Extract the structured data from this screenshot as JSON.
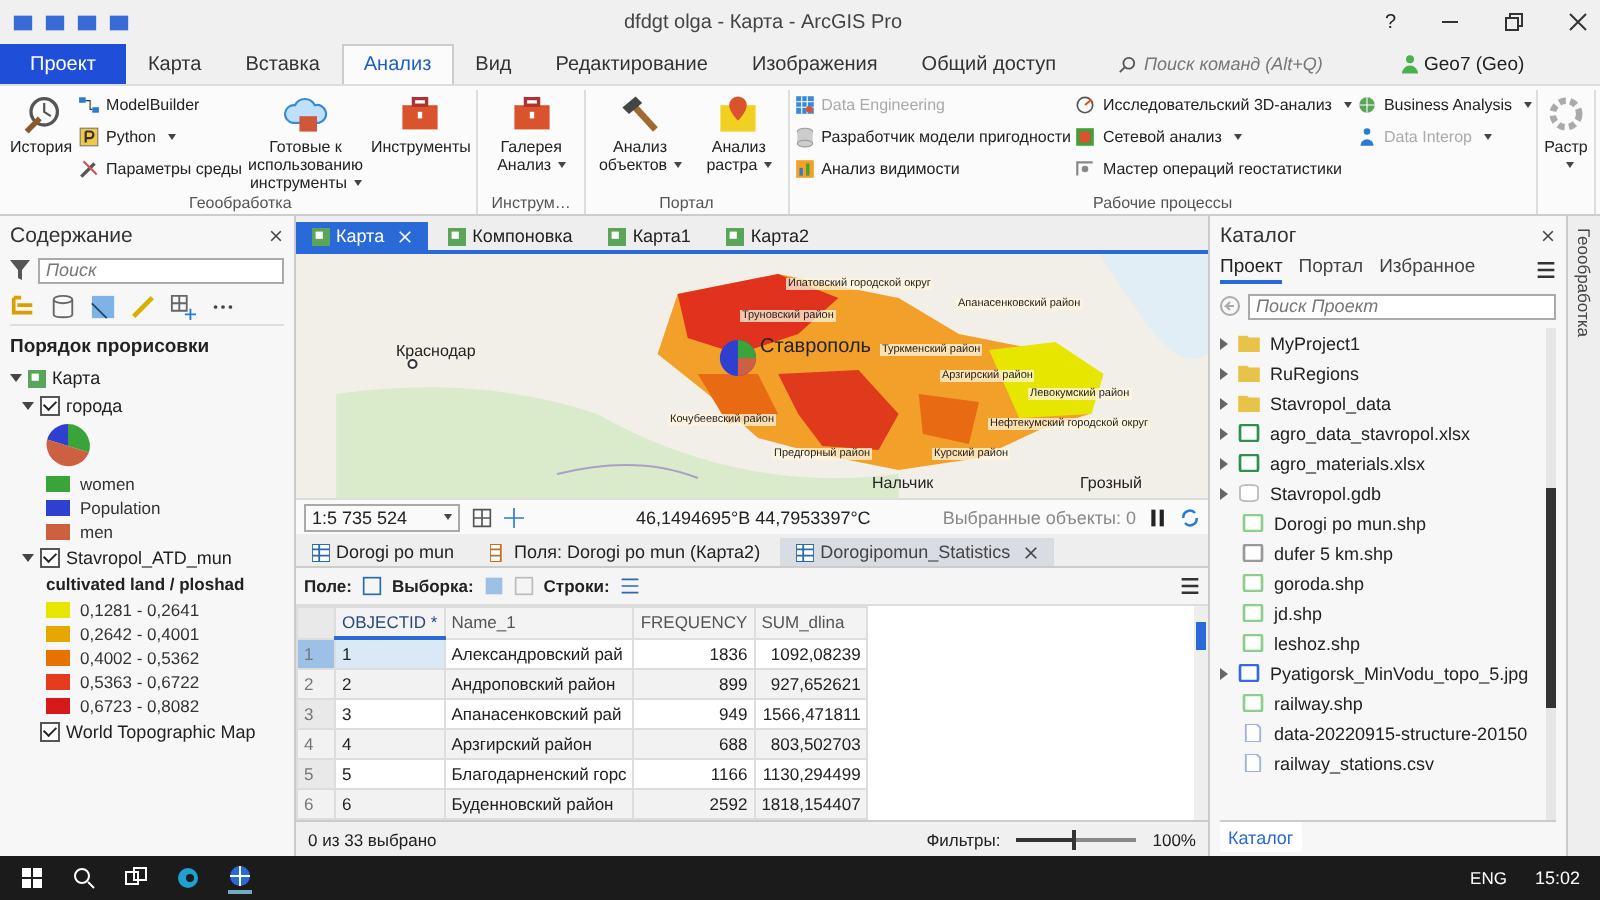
{
  "window": {
    "title": "dfdgt olga - Карта - ArcGIS Pro",
    "help": "?"
  },
  "ribbon_tabs": [
    {
      "label": "Проект",
      "kind": "file",
      "selected": false
    },
    {
      "label": "Карта",
      "kind": "tab",
      "selected": false
    },
    {
      "label": "Вставка",
      "kind": "tab",
      "selected": false
    },
    {
      "label": "Анализ",
      "kind": "tab",
      "selected": true
    },
    {
      "label": "Вид",
      "kind": "tab",
      "selected": false
    },
    {
      "label": "Редактирование",
      "kind": "tab",
      "selected": false
    },
    {
      "label": "Изображения",
      "kind": "tab",
      "selected": false
    },
    {
      "label": "Общий доступ",
      "kind": "tab",
      "selected": false
    }
  ],
  "command_search": {
    "placeholder": "Поиск команд (Alt+Q)"
  },
  "user": {
    "name": "Geo7 (Geo)"
  },
  "ribbon_groups": [
    {
      "title": "Геообработка",
      "columns": [
        {
          "kind": "large",
          "label": "История",
          "dropdown": false
        },
        {
          "kind": "stack",
          "items": [
            {
              "label": "ModelBuilder",
              "dropdown": false,
              "disabled": false
            },
            {
              "label": "Python",
              "dropdown": true,
              "disabled": false
            },
            {
              "label": "Параметры среды",
              "dropdown": false,
              "disabled": false
            }
          ]
        },
        {
          "kind": "large",
          "label": "Готовые к использованию инструменты",
          "dropdown": true
        },
        {
          "kind": "large",
          "label": "Инструменты",
          "dropdown": false
        }
      ]
    },
    {
      "title": "Инструм…",
      "columns": [
        {
          "kind": "large",
          "label": "Галерея Анализ",
          "dropdown": true
        }
      ]
    },
    {
      "title": "Портал",
      "columns": [
        {
          "kind": "large",
          "label": "Анализ объектов",
          "dropdown": true
        },
        {
          "kind": "large",
          "label": "Анализ растра",
          "dropdown": true
        }
      ]
    },
    {
      "title": "Рабочие процессы",
      "columns": [
        {
          "kind": "stack",
          "items": [
            {
              "label": "Data Engineering",
              "dropdown": false,
              "disabled": true
            },
            {
              "label": "Разработчик модели пригодности",
              "dropdown": false,
              "disabled": false
            },
            {
              "label": "Анализ видимости",
              "dropdown": false,
              "disabled": false
            }
          ]
        },
        {
          "kind": "stack",
          "items": [
            {
              "label": "Исследовательский 3D-анализ",
              "dropdown": true,
              "disabled": false
            },
            {
              "label": "Сетевой анализ",
              "dropdown": true,
              "disabled": false
            },
            {
              "label": "Мастер операций геостатистики",
              "dropdown": false,
              "disabled": false
            }
          ]
        },
        {
          "kind": "stack",
          "items": [
            {
              "label": "Business Analysis",
              "dropdown": true,
              "disabled": false
            },
            {
              "label": "Data Interop",
              "dropdown": true,
              "disabled": true
            }
          ]
        }
      ]
    },
    {
      "columns": [
        {
          "kind": "large",
          "label": "Растр",
          "dropdown": true
        }
      ]
    }
  ],
  "contents_pane": {
    "title": "Содержание",
    "search": {
      "placeholder": "Поиск"
    },
    "heading": "Порядок прорисовки",
    "tree": [
      {
        "label": "Карта",
        "kind": "map",
        "expanded": true,
        "children": [
          {
            "label": "города",
            "kind": "layer",
            "checked": true,
            "expanded": true,
            "legend": {
              "kind": "pie",
              "items": [
                {
                  "label": "women",
                  "color": "#3aa33a"
                },
                {
                  "label": "Population",
                  "color": "#2f3fd0"
                },
                {
                  "label": "men",
                  "color": "#cc6040"
                }
              ]
            }
          },
          {
            "label": "Stavropol_ATD_mun",
            "kind": "layer",
            "checked": true,
            "expanded": true,
            "legend": {
              "kind": "classes",
              "title": "cultivated land / ploshad",
              "items": [
                {
                  "label": "0,1281 - 0,2641",
                  "color": "#e6e600"
                },
                {
                  "label": "0,2642 - 0,4001",
                  "color": "#e6a800"
                },
                {
                  "label": "0,4002 - 0,5362",
                  "color": "#e67300"
                },
                {
                  "label": "0,5363 - 0,6722",
                  "color": "#e63c1e"
                },
                {
                  "label": "0,6723 - 0,8082",
                  "color": "#d7191c"
                }
              ]
            }
          },
          {
            "label": "World Topographic Map",
            "kind": "layer",
            "checked": true
          }
        ]
      }
    ]
  },
  "map_view": {
    "tabs": [
      {
        "label": "Карта",
        "selected": true,
        "closable": true
      },
      {
        "label": "Компоновка",
        "selected": false,
        "closable": false
      },
      {
        "label": "Карта1",
        "selected": false,
        "closable": false
      },
      {
        "label": "Карта2",
        "selected": false,
        "closable": false
      }
    ],
    "labels": [
      {
        "text": "Ипатовский городской округ",
        "kind": "district"
      },
      {
        "text": "Апанасенковский район",
        "kind": "district"
      },
      {
        "text": "Труновский район",
        "kind": "district"
      },
      {
        "text": "Краснодар",
        "kind": "city"
      },
      {
        "text": "Ставрополь",
        "kind": "capital"
      },
      {
        "text": "Туркменский район",
        "kind": "district"
      },
      {
        "text": "Арзгирский район",
        "kind": "district"
      },
      {
        "text": "Левокумский район",
        "kind": "district"
      },
      {
        "text": "Кочубеевский район",
        "kind": "district"
      },
      {
        "text": "Нефтекумский городской округ",
        "kind": "district"
      },
      {
        "text": "Предгорный район",
        "kind": "district"
      },
      {
        "text": "Курский район",
        "kind": "district"
      },
      {
        "text": "Нальчик",
        "kind": "city"
      },
      {
        "text": "Грозный",
        "kind": "city"
      }
    ],
    "scale": "1:5 735 524",
    "coordinates": "46,1494695°В 44,7953397°С",
    "selected_features": "Выбранные объекты: 0"
  },
  "table_view": {
    "tabs": [
      {
        "label": "Dorogi po mun",
        "kind": "table",
        "selected": false,
        "closable": false
      },
      {
        "label": "Поля:  Dorogi po mun (Карта2)",
        "kind": "fields",
        "selected": false,
        "closable": false
      },
      {
        "label": "Dorogipomun_Statistics",
        "kind": "table",
        "selected": true,
        "closable": true
      }
    ],
    "toolbar": {
      "field": "Поле:",
      "selection": "Выборка:",
      "rows": "Строки:"
    },
    "columns": [
      "OBJECTID *",
      "Name_1",
      "FREQUENCY",
      "SUM_dlina"
    ],
    "rows": [
      {
        "number": "1",
        "selected": true,
        "cells": [
          "1",
          "Александровский рай",
          "1836",
          "1092,08239"
        ]
      },
      {
        "number": "2",
        "selected": false,
        "cells": [
          "2",
          "Андроповский район",
          "899",
          "927,652621"
        ]
      },
      {
        "number": "3",
        "selected": false,
        "cells": [
          "3",
          "Апанасенковский рай",
          "949",
          "1566,471811"
        ]
      },
      {
        "number": "4",
        "selected": false,
        "cells": [
          "4",
          "Арзгирский район",
          "688",
          "803,502703"
        ]
      },
      {
        "number": "5",
        "selected": false,
        "cells": [
          "5",
          "Благодарненский горс",
          "1166",
          "1130,294499"
        ]
      },
      {
        "number": "6",
        "selected": false,
        "cells": [
          "6",
          "Буденновский район",
          "2592",
          "1818,154407"
        ]
      }
    ],
    "status": "0 из 33 выбрано",
    "filters": "Фильтры:",
    "zoom": {
      "level": 0.5,
      "reading": "100%"
    }
  },
  "catalog_pane": {
    "title": "Каталог",
    "tabs": [
      {
        "label": "Проект",
        "selected": true
      },
      {
        "label": "Портал",
        "selected": false
      },
      {
        "label": "Избранное",
        "selected": false
      }
    ],
    "search": {
      "placeholder": "Поиск Проект"
    },
    "items": [
      {
        "label": "MyProject1",
        "kind": "folder",
        "expanded": false
      },
      {
        "label": "RuRegions",
        "kind": "folder",
        "expanded": false
      },
      {
        "label": "Stavropol_data",
        "kind": "folder",
        "expanded": false
      },
      {
        "label": "agro_data_stavropol.xlsx",
        "kind": "spreadsheet",
        "expanded": false
      },
      {
        "label": "agro_materials.xlsx",
        "kind": "spreadsheet",
        "expanded": false
      },
      {
        "label": "Stavropol.gdb",
        "kind": "geodatabase",
        "expanded": false
      },
      {
        "label": "Dorogi po mun.shp",
        "kind": "line"
      },
      {
        "label": "dufer 5 km.shp",
        "kind": "polygon"
      },
      {
        "label": "goroda.shp",
        "kind": "point"
      },
      {
        "label": "jd.shp",
        "kind": "point"
      },
      {
        "label": "leshoz.shp",
        "kind": "point"
      },
      {
        "label": "Pyatigorsk_MinVodu_topo_5.jpg",
        "kind": "raster",
        "expanded": false
      },
      {
        "label": "railway.shp",
        "kind": "point"
      },
      {
        "label": "data-20220915-structure-20150",
        "kind": "file"
      },
      {
        "label": "railway_stations.csv",
        "kind": "file"
      }
    ],
    "bottom_tabs": [
      {
        "label": "Каталог",
        "selected": true
      }
    ]
  },
  "side_tab": "Геообработка",
  "taskbar": {
    "language": "ENG",
    "clock": "15:02"
  }
}
